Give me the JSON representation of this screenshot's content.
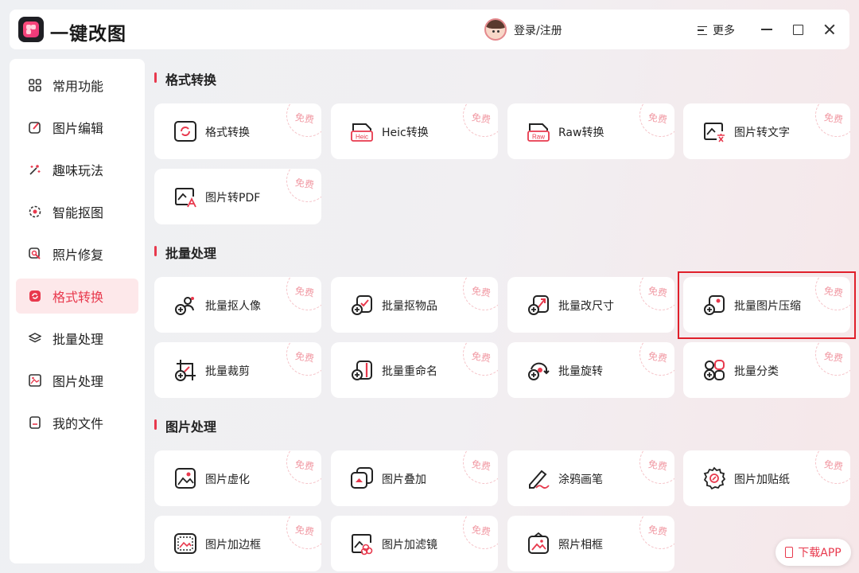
{
  "app": {
    "title": "一键改图"
  },
  "header": {
    "login_label": "登录/注册",
    "more_label": "更多"
  },
  "sidebar": {
    "items": [
      {
        "label": "常用功能",
        "icon": "grid-icon"
      },
      {
        "label": "图片编辑",
        "icon": "edit-icon"
      },
      {
        "label": "趣味玩法",
        "icon": "magic-icon"
      },
      {
        "label": "智能抠图",
        "icon": "target-icon"
      },
      {
        "label": "照片修复",
        "icon": "repair-icon"
      },
      {
        "label": "格式转换",
        "icon": "convert-icon",
        "active": true
      },
      {
        "label": "批量处理",
        "icon": "layers-icon"
      },
      {
        "label": "图片处理",
        "icon": "image-icon"
      },
      {
        "label": "我的文件",
        "icon": "file-icon"
      }
    ]
  },
  "sections": [
    {
      "title": "格式转换",
      "cards": [
        {
          "label": "格式转换",
          "icon": "format-convert-icon"
        },
        {
          "label": "Heic转换",
          "icon": "heic-icon"
        },
        {
          "label": "Raw转换",
          "icon": "raw-icon"
        },
        {
          "label": "图片转文字",
          "icon": "image-to-text-icon"
        },
        {
          "label": "图片转PDF",
          "icon": "image-to-pdf-icon"
        }
      ]
    },
    {
      "title": "批量处理",
      "cards": [
        {
          "label": "批量抠人像",
          "icon": "batch-portrait-cutout-icon"
        },
        {
          "label": "批量抠物品",
          "icon": "batch-object-cutout-icon"
        },
        {
          "label": "批量改尺寸",
          "icon": "batch-resize-icon"
        },
        {
          "label": "批量图片压缩",
          "icon": "batch-compress-icon"
        },
        {
          "label": "批量裁剪",
          "icon": "batch-crop-icon"
        },
        {
          "label": "批量重命名",
          "icon": "batch-rename-icon"
        },
        {
          "label": "批量旋转",
          "icon": "batch-rotate-icon"
        },
        {
          "label": "批量分类",
          "icon": "batch-classify-icon"
        }
      ]
    },
    {
      "title": "图片处理",
      "cards": [
        {
          "label": "图片虚化",
          "icon": "blur-icon"
        },
        {
          "label": "图片叠加",
          "icon": "overlay-icon"
        },
        {
          "label": "涂鸦画笔",
          "icon": "brush-icon"
        },
        {
          "label": "图片加贴纸",
          "icon": "sticker-icon"
        },
        {
          "label": "图片加边框",
          "icon": "border-icon"
        },
        {
          "label": "图片加滤镜",
          "icon": "filter-icon"
        },
        {
          "label": "照片相框",
          "icon": "photo-frame-icon"
        }
      ]
    }
  ],
  "badge_label": "免费",
  "download": {
    "label": "下载APP"
  },
  "colors": {
    "accent": "#e8394d",
    "badge": "#f19aa4",
    "highlight": "#e01f2a"
  }
}
